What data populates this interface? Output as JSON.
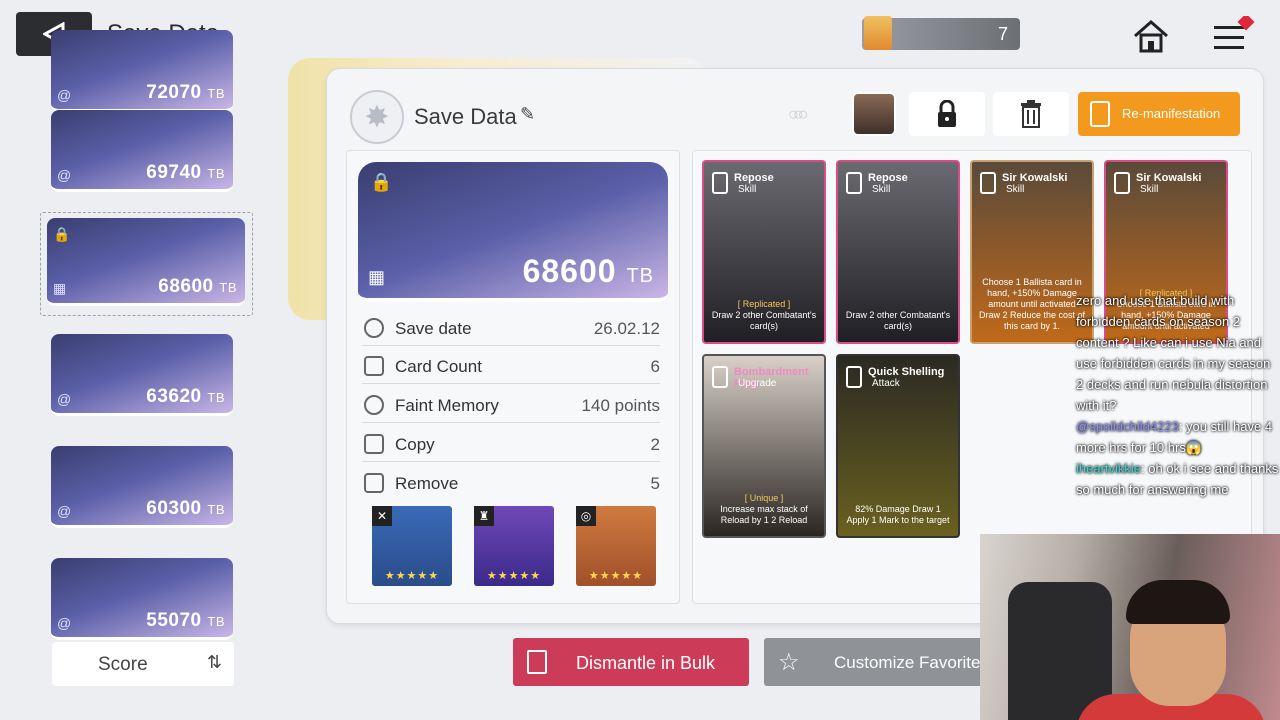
{
  "header": {
    "title": "Save Data",
    "currency_count": "7"
  },
  "list": {
    "items": [
      {
        "value": "72070",
        "unit": "TB"
      },
      {
        "value": "69740",
        "unit": "TB"
      },
      {
        "value": "68600",
        "unit": "TB"
      },
      {
        "value": "63620",
        "unit": "TB"
      },
      {
        "value": "60300",
        "unit": "TB"
      },
      {
        "value": "55070",
        "unit": "TB"
      }
    ],
    "sort_label": "Score"
  },
  "detail": {
    "title": "Save Data",
    "rings_label": "RES ISSUANCE",
    "remanifest_label": "Re-manifestation",
    "hero_value": "68600",
    "hero_unit": "TB",
    "stats": [
      {
        "key": "Save date",
        "value": "26.02.12"
      },
      {
        "key": "Card Count",
        "value": "6"
      },
      {
        "key": "Faint Memory",
        "value": "140 points"
      },
      {
        "key": "Copy",
        "value": "2"
      },
      {
        "key": "Remove",
        "value": "5"
      }
    ],
    "equipment_stars": "★★★★★"
  },
  "cards": [
    {
      "name": "Repose",
      "type": "Skill",
      "tag": "[ Replicated ]",
      "text": "Draw 2 other Combatant's card(s)"
    },
    {
      "name": "Repose",
      "type": "Skill",
      "tag": "",
      "text": "Draw 2 other Combatant's card(s)"
    },
    {
      "name": "Sir Kowalski",
      "type": "Skill",
      "tag": "",
      "text": "Choose 1 Ballista card in hand, +150% Damage amount until activated Draw 2 Reduce the cost of this card by 1."
    },
    {
      "name": "Sir Kowalski",
      "type": "Skill",
      "tag": "[ Replicated ]",
      "text": "Choose 1 Ballista card in hand, +150% Damage amount until activated"
    },
    {
      "name": "Bombardment Prep",
      "type": "Upgrade",
      "tag": "[ Unique ]",
      "text": "Increase max stack of Reload by 1 2 Reload"
    },
    {
      "name": "Quick Shelling",
      "type": "Attack",
      "tag": "",
      "text": "82% Damage Draw 1 Apply 1 Mark to the target"
    }
  ],
  "actions": {
    "dismantle": "Dismantle in Bulk",
    "customize": "Customize Favorites"
  },
  "chat": {
    "msg1": "zero and use that build with forbidden cards on season 2 content ? Like can i use Nia and use forbidden cards in my season 2 decks and run nebula distortion with it?",
    "user2": "@spoildchild4223",
    "msg2": ": you still have 4 more hrs for 10 hrs😱",
    "user3": "iheartvikkie",
    "msg3": ": oh ok i see and thanks so much for answering me"
  },
  "colors": {
    "accent_orange": "#f39a1e",
    "dismantle_red": "#cc3b58",
    "card_border": "#d94c86"
  }
}
